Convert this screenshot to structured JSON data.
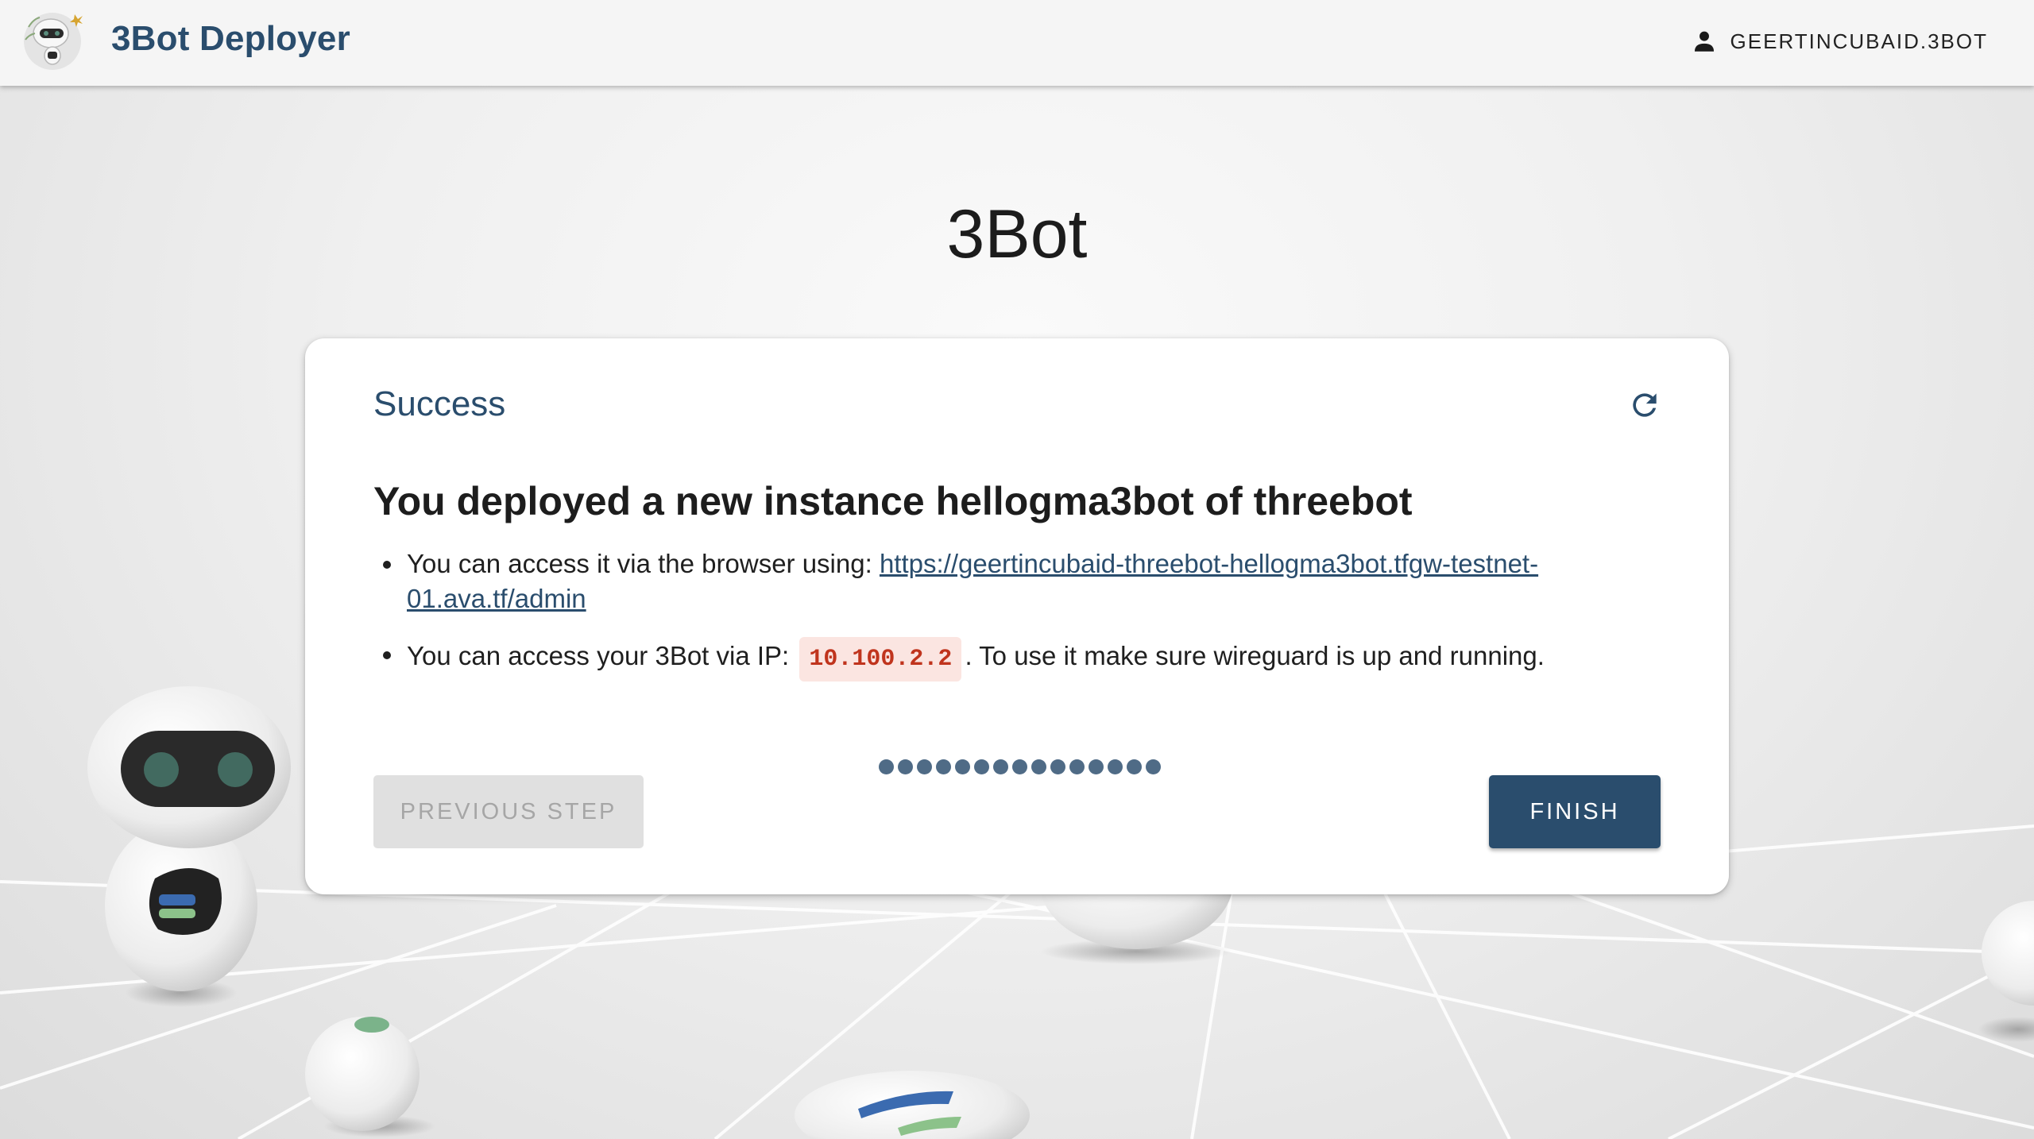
{
  "header": {
    "app_title": "3Bot Deployer",
    "user_name": "GEERTINCUBAID.3BOT"
  },
  "page": {
    "heading": "3Bot"
  },
  "card": {
    "step_title": "Success",
    "result_heading": "You deployed a new instance hellogma3bot of threebot",
    "browser_access_prefix": "You can access it via the browser using: ",
    "browser_access_url": "https://geertincubaid-threebot-hellogma3bot.tfgw-testnet-01.ava.tf/admin",
    "ip_access_prefix": "You can access your 3Bot via IP: ",
    "ip_address": "10.100.2.2",
    "ip_access_suffix": ". To use it make sure wireguard is up and running.",
    "steps_total": 15,
    "steps_completed": 15,
    "previous_step_label": "PREVIOUS STEP",
    "finish_label": "FINISH"
  },
  "colors": {
    "brand": "#2a4d6d",
    "step_dot": "#4f6b86",
    "code_background": "#fbe5e1",
    "code_text": "#c0341d"
  },
  "icons": {
    "logo": "3bot-robot-logo",
    "user": "account-icon",
    "refresh": "refresh-icon"
  }
}
